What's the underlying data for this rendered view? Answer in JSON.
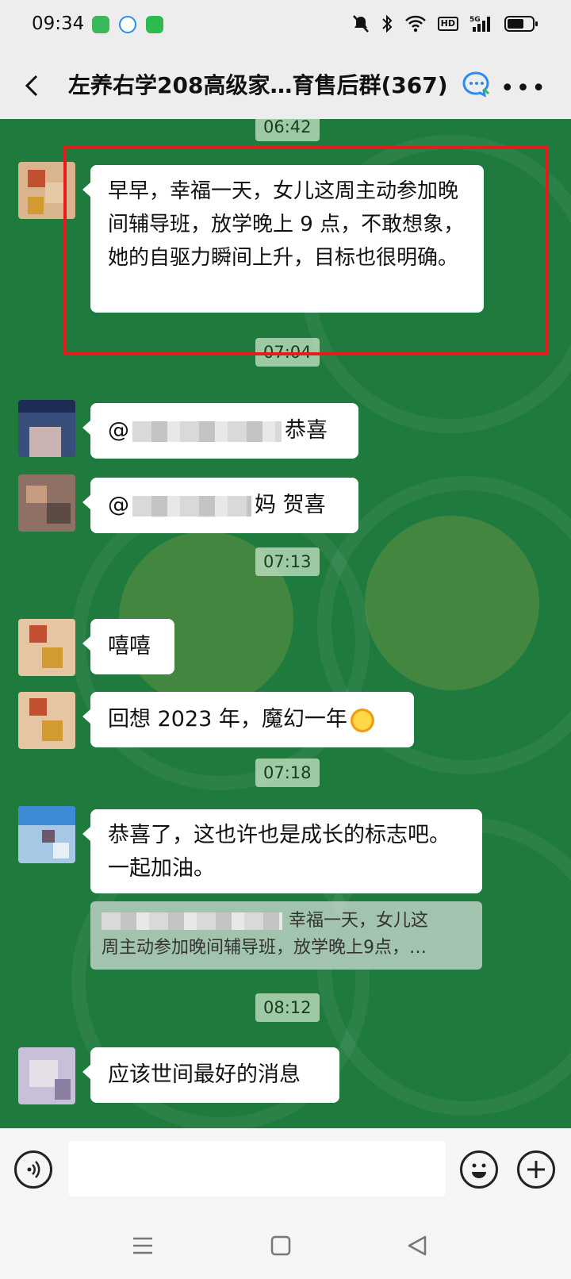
{
  "status_bar": {
    "time": "09:34",
    "hd": "HD",
    "network": "5G"
  },
  "header": {
    "title": "左养右学208高级家…育售后群(367)"
  },
  "messages": {
    "t1": "06:42",
    "m1": "早早，幸福一天，女儿这周主动参加晚间辅导班，放学晚上 9 点，不敢想象，她的自驱力瞬间上升，目标也很明确。",
    "t2": "07:04",
    "m2_prefix": "@",
    "m2_suffix": "恭喜",
    "m3_prefix": "@",
    "m3_suffix": "妈  贺喜",
    "t3": "07:13",
    "m4": "嘻嘻",
    "m5": "回想 2023 年，魔幻一年",
    "t4": "07:18",
    "m6": "恭喜了，这也许也是成长的标志吧。一起加油。",
    "quote_line1": "幸福一天，女儿这",
    "quote_line2": "周主动参加晚间辅导班，放学晚上9点，…",
    "t5": "08:12",
    "m7": "应该世间最好的消息"
  },
  "colors": {
    "chat_bg": "#1f7a3e",
    "highlight": "#e61c1c"
  },
  "icons": [
    "back-icon",
    "chat-ai-icon",
    "more-icon",
    "voice-icon",
    "emoji-icon",
    "add-icon",
    "menu-nav-icon",
    "home-nav-icon",
    "back-nav-icon"
  ]
}
